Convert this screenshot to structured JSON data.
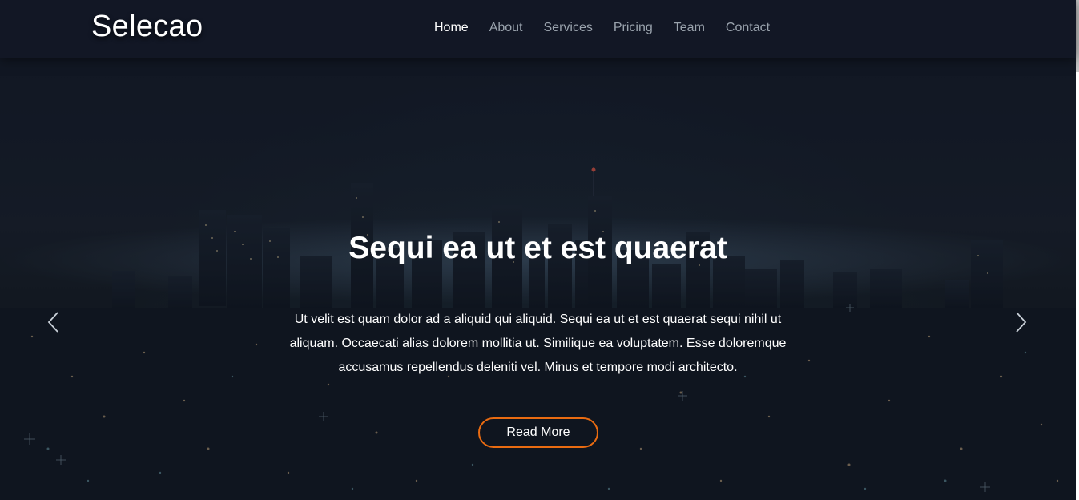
{
  "header": {
    "logo": "Selecao",
    "nav": [
      {
        "label": "Home",
        "active": true
      },
      {
        "label": "About",
        "active": false
      },
      {
        "label": "Services",
        "active": false
      },
      {
        "label": "Pricing",
        "active": false
      },
      {
        "label": "Team",
        "active": false
      },
      {
        "label": "Contact",
        "active": false
      }
    ]
  },
  "hero": {
    "title": "Sequi ea ut et est quaerat",
    "text": "Ut velit est quam dolor ad a aliquid qui aliquid. Sequi ea ut et est quaerat sequi nihil ut aliquam. Occaecati alias dolorem mollitia ut. Similique ea voluptatem. Esse doloremque accusamus repellendus deleniti vel. Minus et tempore modi architecto.",
    "button": "Read More",
    "prev_icon": "chevron-left-icon",
    "next_icon": "chevron-right-icon"
  },
  "colors": {
    "accent": "#e96b11",
    "header_bg": "#121826",
    "text": "#ffffff",
    "nav_inactive": "#9aa3ad"
  }
}
